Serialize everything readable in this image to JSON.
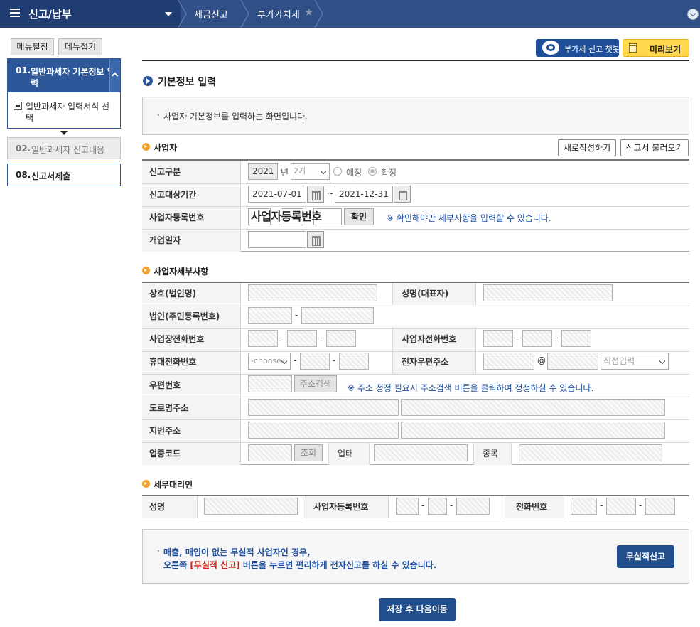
{
  "topbar": {
    "menu_title": "신고/납부",
    "breadcrumb1": "세금신고",
    "breadcrumb2": "부가가치세"
  },
  "sidebar": {
    "expand_label": "메뉴펼침",
    "collapse_label": "메뉴접기",
    "step1_num": "01.",
    "step1_label_line1": "일반과세자 기본정보 입",
    "step1_label_line2": "력",
    "step1_sub_line1": "일반과세자 입력서식 선",
    "step1_sub_line2": "택",
    "step2_num": "02.",
    "step2_label": "일반과세자 신고내용",
    "step3_num": "08.",
    "step3_label": "신고서제출"
  },
  "toolbar": {
    "chatbot_label": "부가세 신고 챗봇",
    "preview_label": "미리보기"
  },
  "page": {
    "title": "기본정보 입력",
    "info": "사업자 기본정보를 입력하는 화면입니다."
  },
  "business": {
    "section_title": "사업자",
    "new_button": "새로작성하기",
    "load_button": "신고서 불러오기",
    "type_label": "신고구분",
    "year_value": "2021",
    "year_unit": "년",
    "period_value": "2기",
    "radio_scheduled": "예정",
    "radio_final": "확정",
    "period_label": "신고대상기간",
    "start_date": "2021-07-01",
    "tilde": "~",
    "end_date": "2021-12-31",
    "regno_label": "사업자등록번호",
    "regno_overlay": "사업자등록번호",
    "confirm_button": "확인",
    "regno_note": "※ 확인해야만 세부사항을 입력할 수 있습니다.",
    "open_date_label": "개업일자"
  },
  "details": {
    "section_title": "사업자세부사항",
    "company_label": "상호(법인명)",
    "rep_label": "성명(대표자)",
    "corp_no_label": "법인(주민등록번호)",
    "biz_phone_label": "사업장전화번호",
    "owner_phone_label": "사업자전화번호",
    "mobile_label": "휴대전화번호",
    "mobile_select": "-choose-",
    "email_label": "전자우편주소",
    "at_sign": "@",
    "email_domain_select": "직접입력",
    "zip_label": "우편번호",
    "address_search_button": "주소검색",
    "zip_note": "※ 주소 정정 필요시 주소검색 버튼을 클릭하여 정정하실 수 있습니다.",
    "road_label": "도로명주소",
    "lot_label": "지번주소",
    "industry_label": "업종코드",
    "lookup_button": "조회",
    "biz_type_label": "업태",
    "biz_item_label": "종목",
    "dash": "-"
  },
  "agent": {
    "section_title": "세무대리인",
    "name_label": "성명",
    "regno_label": "사업자등록번호",
    "phone_label": "전화번호"
  },
  "notice": {
    "line1": "매출, 매입이 없는 무실적 사업자인 경우,",
    "line2_pre": "오른쪽 ",
    "line2_red": "[무실적 신고]",
    "line2_post": " 버튼을 누르면 편리하게 전자신고를 하실 수 있습니다.",
    "button": "무실적신고"
  },
  "footer": {
    "save_next": "저장 후 다음이동"
  },
  "colors": {
    "topbar": "#2f4f86",
    "accent": "#234e8c",
    "orange": "#f1a12d",
    "red": "#d0201a",
    "yellow": "#ffd84d"
  }
}
